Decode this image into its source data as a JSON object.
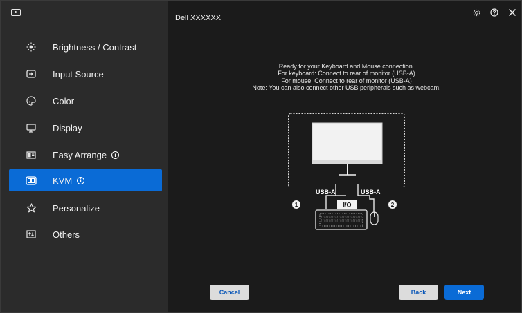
{
  "app": {
    "title": "Dell XXXXXX"
  },
  "sidebar": {
    "items": [
      {
        "label": "Brightness / Contrast",
        "icon": "sun-icon",
        "active": false
      },
      {
        "label": "Input Source",
        "icon": "input-source-icon",
        "active": false
      },
      {
        "label": "Color",
        "icon": "palette-icon",
        "active": false
      },
      {
        "label": "Display",
        "icon": "monitor-icon",
        "active": false
      },
      {
        "label": "Easy Arrange",
        "icon": "layout-icon",
        "active": false,
        "info": true
      },
      {
        "label": "KVM",
        "icon": "kvm-icon",
        "active": true,
        "info": true
      },
      {
        "label": "Personalize",
        "icon": "star-icon",
        "active": false
      },
      {
        "label": "Others",
        "icon": "others-icon",
        "active": false
      }
    ]
  },
  "header": {
    "icons": [
      "settings-icon",
      "help-icon",
      "close-icon"
    ]
  },
  "main": {
    "instructions": [
      "Ready for your Keyboard and Mouse connection.",
      "For keyboard: Connect to rear of monitor (USB-A)",
      "For mouse:  Connect to rear of monitor (USB-A)",
      "Note: You can also connect other USB peripherals such as webcam."
    ],
    "diagram": {
      "port_left": "USB-A",
      "port_right": "USB-A",
      "io_label": "I/O",
      "marker_1": "1",
      "marker_2": "2"
    }
  },
  "buttons": {
    "cancel": "Cancel",
    "back": "Back",
    "next": "Next"
  },
  "colors": {
    "accent": "#0a6bd6",
    "sidebar_bg": "#2b2b2b",
    "main_bg": "#1b1b1b"
  }
}
